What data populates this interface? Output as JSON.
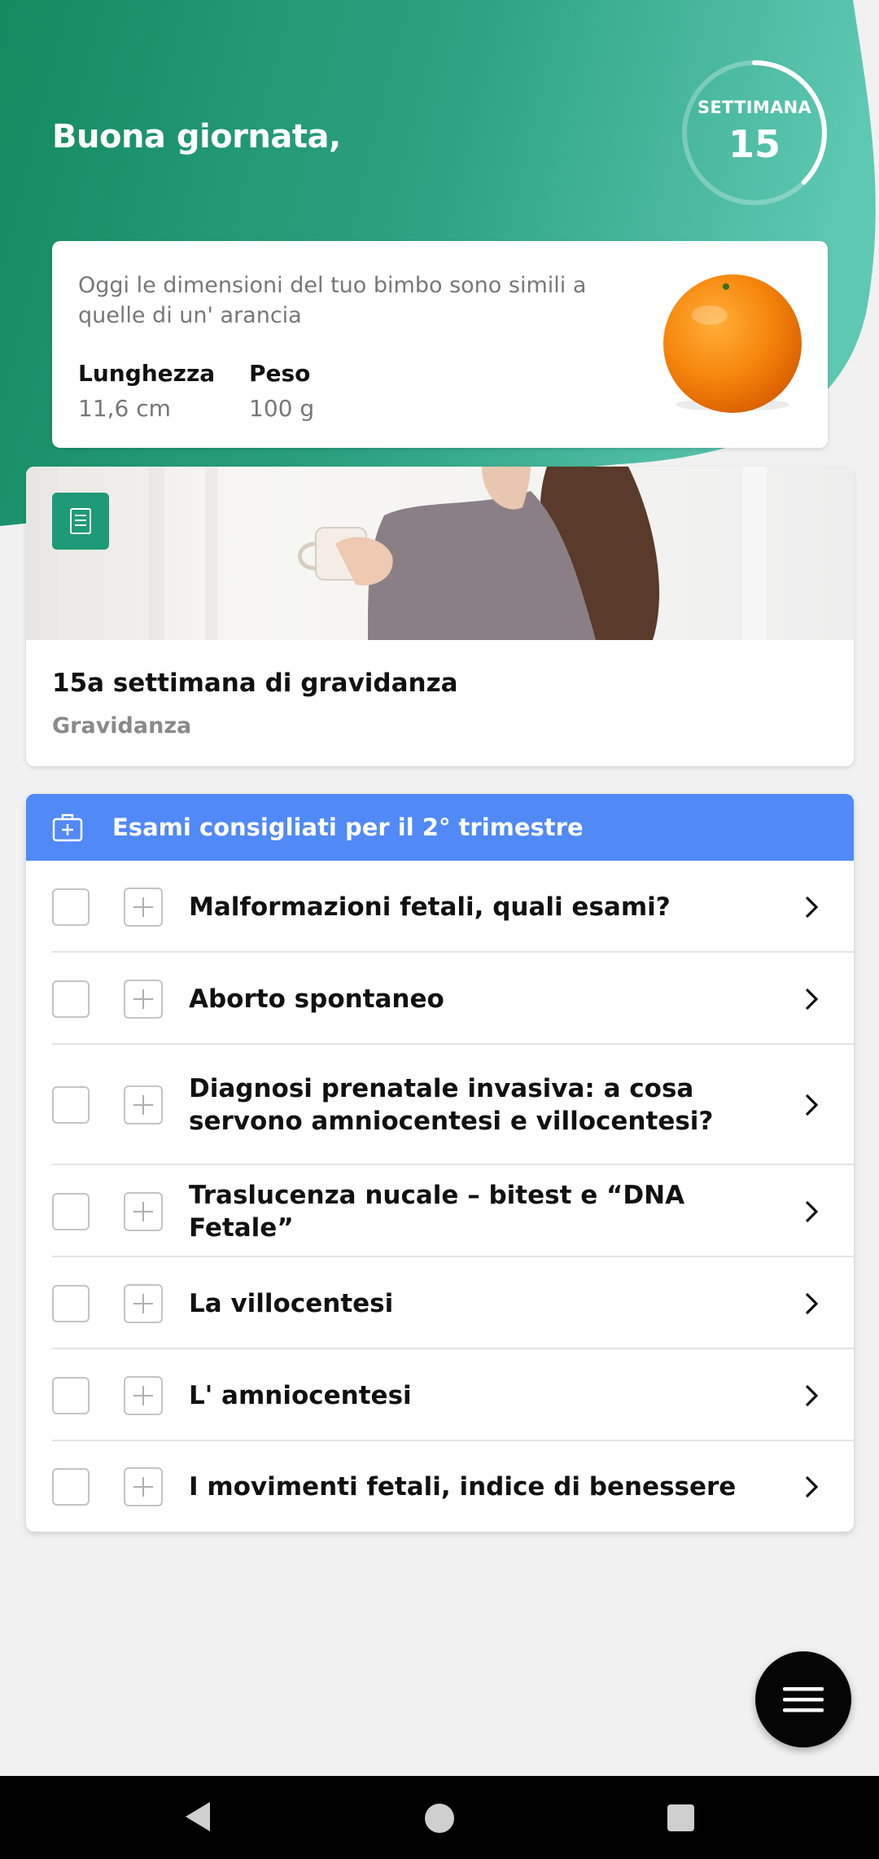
{
  "header": {
    "greeting": "Buona giornata,",
    "week_label": "SETTIMANA",
    "week_number": "15",
    "week_progress": 0.375,
    "colors": {
      "gradient_start": "#148a62",
      "gradient_end": "#5cc7b1"
    }
  },
  "baby_size": {
    "description": "Oggi le dimensioni del tuo bimbo sono simili a quelle di un' arancia",
    "length_label": "Lunghezza",
    "length_value": "11,6 cm",
    "weight_label": "Peso",
    "weight_value": "100 g",
    "fruit_icon": "orange-image"
  },
  "article": {
    "badge_icon": "document-icon",
    "title": "15a settimana di gravidanza",
    "category": "Gravidanza"
  },
  "exams": {
    "header_icon": "medical-kit-icon",
    "title": "Esami consigliati per il 2° trimestre",
    "accent_color": "#5189f7",
    "items": [
      {
        "label": "Malformazioni fetali, quali esami?"
      },
      {
        "label": "Aborto spontaneo"
      },
      {
        "label": "Diagnosi prenatale invasiva: a cosa servono amniocentesi e villocentesi?"
      },
      {
        "label": "Traslucenza nucale – bitest e “DNA Fetale”"
      },
      {
        "label": "La villocentesi"
      },
      {
        "label": "L' amniocentesi"
      },
      {
        "label": "I movimenti fetali, indice di benessere"
      }
    ]
  },
  "fab": {
    "icon": "menu-icon"
  },
  "system_nav": {
    "back_icon": "back-icon",
    "home_icon": "home-icon",
    "recents_icon": "recents-icon"
  }
}
